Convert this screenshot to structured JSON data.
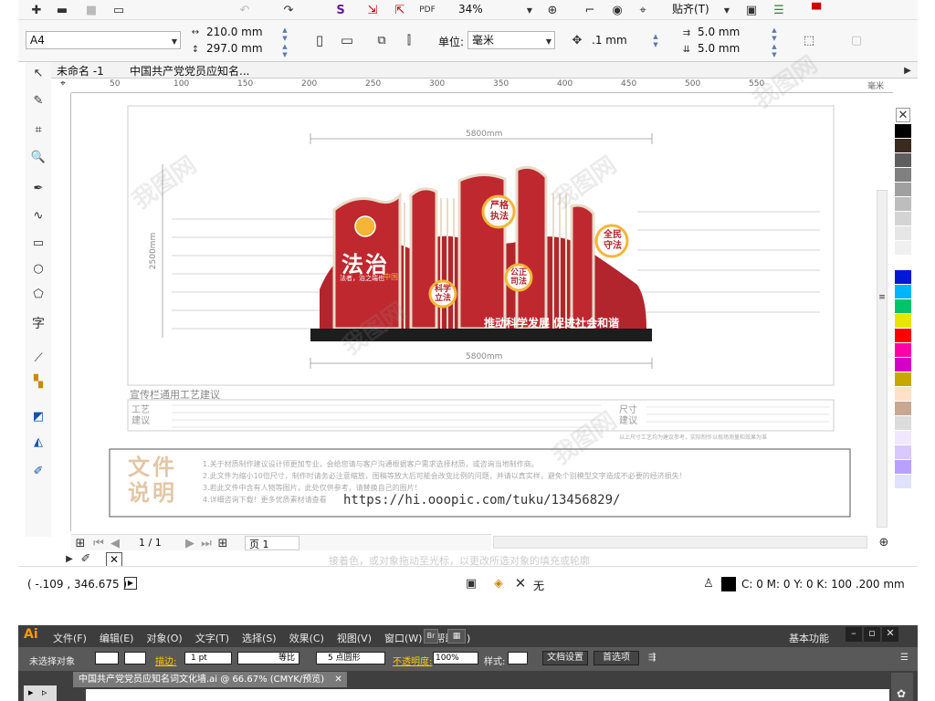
{
  "toolbar1": {
    "zoom": "34%",
    "snap_label": "贴齐(T)"
  },
  "toolbar2": {
    "page_size": "A4",
    "width": "210.0 mm",
    "height": "297.0 mm",
    "unit_label": "单位:",
    "unit": "毫米",
    "nudge": ".1 mm",
    "dup_x": "5.0 mm",
    "dup_y": "5.0 mm"
  },
  "doc_tabs": [
    "未命名 -1",
    "中国共产党党员应知名..."
  ],
  "ruler_h": [
    "50",
    "100",
    "150",
    "200",
    "250",
    "300",
    "350",
    "400",
    "450",
    "500",
    "550",
    "毫米"
  ],
  "design": {
    "dim_top": "5800mm",
    "dim_bottom": "5800mm",
    "dim_left": "2500mm",
    "main_title": "法治",
    "main_sub": "中国",
    "main_small": "法者，治之端也",
    "badges": [
      "严格执法",
      "全民守法",
      "科学立法",
      "公正司法"
    ],
    "slogan": "推动科学发展 促进社会和谐",
    "craft_title": "宣传栏通用工艺建议",
    "craft_left": "工艺建议",
    "size_left": "尺寸建议",
    "note_small": "以上尺寸工艺均为建议参考，实际制作以现场测量和效果为准"
  },
  "notes": {
    "title": "文件说明",
    "lines": [
      "1.关于材质制作建议设计师更加专业，会给您请与客户沟通根据客户需求选择材质，或咨询当地制作商。",
      "2.此文件为缩小10倍尺寸，制作时请务必注意缩放，图稿等放大后可能会改变比例的问题，并请以真实样，避免个别模型文字造成不必要的经济损失！",
      "3.若此文件中含有人物等图片，此处仅供参考，请替换自己的图片！",
      "4.详细咨询下载！更多优质素材请查看"
    ],
    "url": "https://hi.ooopic.com/tuku/13456829/"
  },
  "page_nav": {
    "page": "1 / 1",
    "page_tab": "页 1"
  },
  "status": {
    "coords": "( -.109 , 346.675 )",
    "fill_none": "无",
    "outline": "C: 0 M: 0 Y: 0 K: 100  .200 mm",
    "hint": "接着色，或对象拖动至光标，以更改所选对象的填充或轮廓"
  },
  "palette_colors": [
    "#000000",
    "#3b2a20",
    "#5e5e5e",
    "#808080",
    "#a0a0a0",
    "#bdbdbd",
    "#d4d4d4",
    "#e6e6e6",
    "#f0f0f0",
    "#ffffff",
    "#0018d6",
    "#00b3ff",
    "#00c46a",
    "#e6e600",
    "#ff0000",
    "#ff00a6",
    "#d400c8",
    "#c8a800",
    "#ffe0c8",
    "#c8a890",
    "#dcdcdc",
    "#f0e8ff",
    "#d8c8ff",
    "#b8a0ff",
    "#e0e0ff"
  ],
  "illustrator": {
    "logo": "Ai",
    "menus": [
      "文件(F)",
      "编辑(E)",
      "对象(O)",
      "文字(T)",
      "选择(S)",
      "效果(C)",
      "视图(V)",
      "窗口(W)",
      "帮助(H)"
    ],
    "workspace": "基本功能",
    "ctrl_selected": "未选择对象",
    "stroke_label": "描边:",
    "stroke_value": "1 pt",
    "stroke_style": "等比",
    "brush": "5 点圆形",
    "opacity_label": "不透明度:",
    "opacity_value": "100%",
    "style_label": "样式:",
    "doc_setup": "文档设置",
    "prefs": "首选项",
    "doc_tab": "中国共产党党员应知名词文化墙.ai @ 66.67% (CMYK/预览)"
  },
  "watermark": "我图网"
}
